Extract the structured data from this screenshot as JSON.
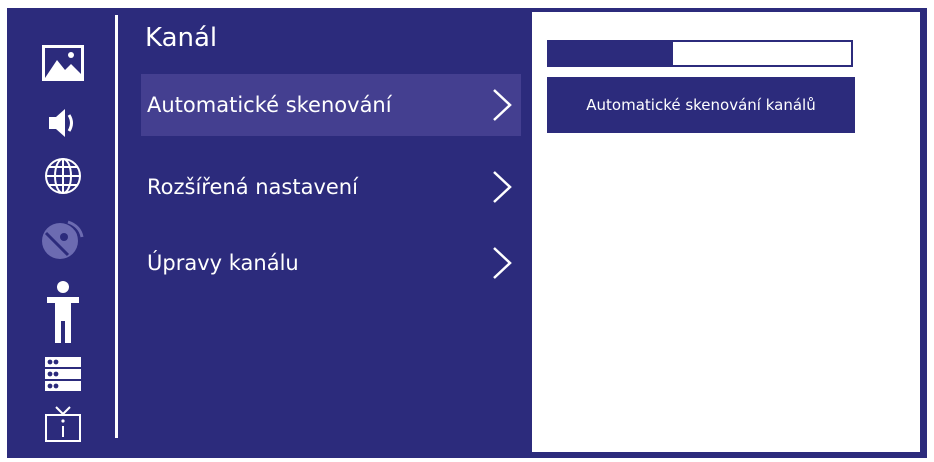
{
  "sidebar": {
    "icons": [
      "picture-icon",
      "sound-icon",
      "globe-icon",
      "satellite-dish-icon",
      "parental-lock-icon",
      "channel-list-icon",
      "tv-info-icon"
    ]
  },
  "menu": {
    "title": "Kanál",
    "items": [
      {
        "label": "Automatické skenování",
        "selected": true
      },
      {
        "label": "Rozšířená nastavení",
        "selected": false
      },
      {
        "label": "Úpravy kanálu",
        "selected": false
      }
    ]
  },
  "panel": {
    "progress_fraction": 0.41,
    "scan_button_label": "Automatické skenování kanálů"
  },
  "colors": {
    "background": "#2c2b7c",
    "selected": "#443f90",
    "text": "#ffffff"
  }
}
